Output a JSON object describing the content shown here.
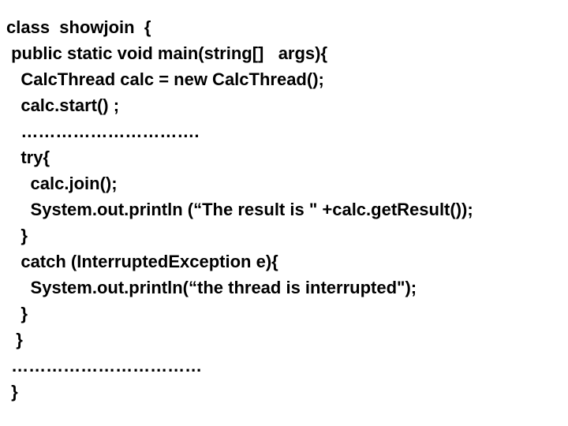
{
  "code": {
    "lines": [
      "class  showjoin  {",
      " public static void main(string[]   args){",
      "   CalcThread calc = new CalcThread();",
      "   calc.start() ;",
      "   ………………………….",
      "   try{",
      "     calc.join();",
      "     System.out.println (“The result is \" +calc.getResult());",
      "   }",
      "   catch (InterruptedException e){",
      "     System.out.println(“the thread is interrupted\");",
      "   }",
      "  }",
      " ……………………………",
      " }"
    ]
  }
}
